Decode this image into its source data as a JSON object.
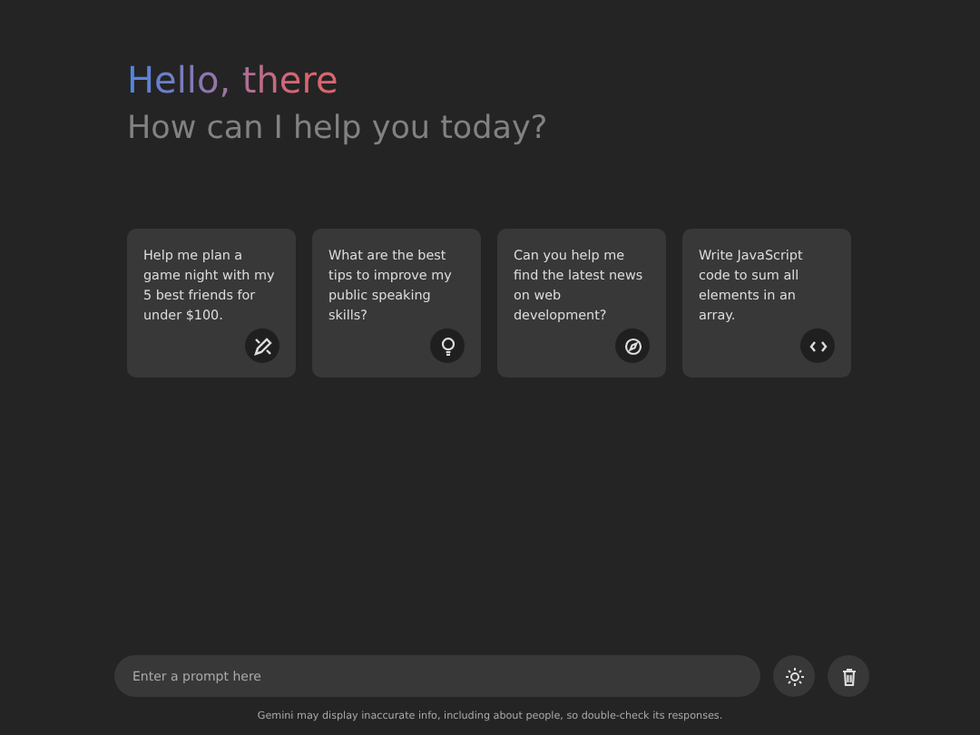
{
  "greeting": {
    "title": "Hello, there",
    "subtitle": "How can I help you today?"
  },
  "suggestions": [
    {
      "text": "Help me plan a game night with my 5 best friends for under $100.",
      "kind": "draw"
    },
    {
      "text": "What are the best tips to improve my public speaking skills?",
      "kind": "bulb"
    },
    {
      "text": "Can you help me find the latest news on web development?",
      "kind": "compass"
    },
    {
      "text": "Write JavaScript code to sum all elements in an array.",
      "kind": "code"
    }
  ],
  "prompt": {
    "placeholder": "Enter a prompt here"
  },
  "disclaimer": "Gemini may display inaccurate info, including about people, so double-check its responses."
}
